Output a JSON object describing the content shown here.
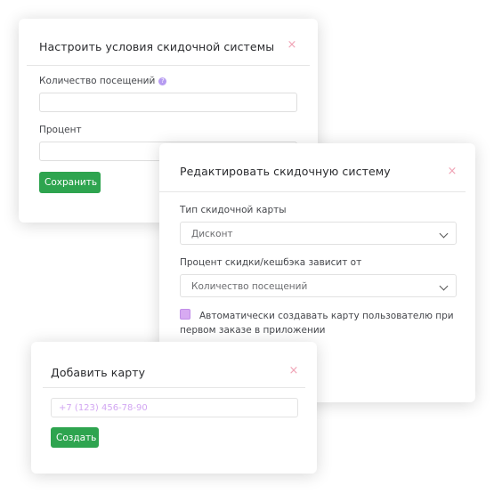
{
  "discount_modal": {
    "title": "Настроить условия скидочной системы",
    "visits_label": "Количество посещений",
    "help_glyph": "?",
    "percent_label": "Процент",
    "save_button": "Сохранить",
    "close_glyph": "×"
  },
  "edit_modal": {
    "title": "Редактировать скидочную систему",
    "card_type_label": "Тип скидочной карты",
    "card_type_value": "Дисконт",
    "depends_label": "Процент скидки/кешбэка зависит от",
    "depends_value": "Количество посещений",
    "auto_create_line1": "Автоматически создавать карту пользователю при",
    "auto_create_line2": "первом заказе в приложении",
    "close_glyph": "×"
  },
  "add_card_modal": {
    "title": "Добавить карту",
    "phone_placeholder": "+7 (123) 456-78-90",
    "create_button": "Создать",
    "close_glyph": "×"
  },
  "colors": {
    "accent_green": "#2ea44f",
    "close_pink": "#f0a3b5",
    "checkbox_purple": "#d7aaf2"
  }
}
